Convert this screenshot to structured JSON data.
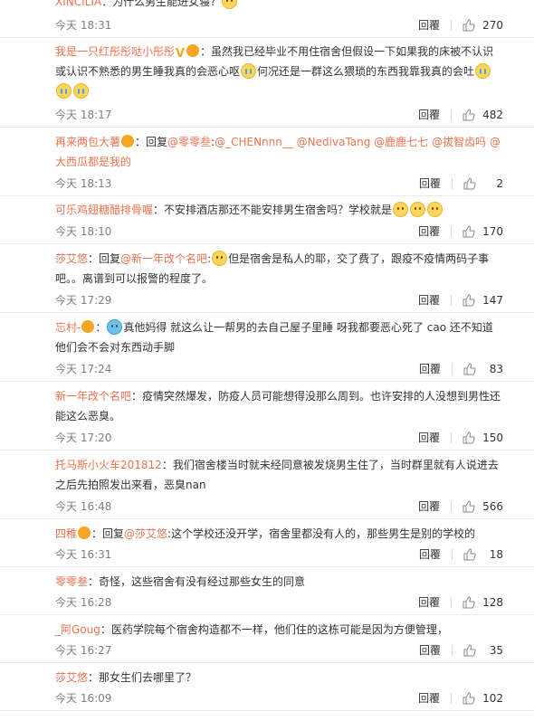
{
  "comments": [
    {
      "user": "XINCILIA",
      "parts": [
        {
          "t": "text",
          "v": "：为什么男生能进女寝？"
        },
        {
          "t": "emoji",
          "cls": ""
        }
      ],
      "time": "今天 18:31",
      "reply": "回覆",
      "likes": "270"
    },
    {
      "user": "我是一只红彤彤哒小彤彤",
      "badge": "V",
      "parts": [
        {
          "t": "text",
          "v": "：虽然我已经毕业不用住宿舍但假设一下如果我的床被不认识或认识不熟悉的男生睡我真的会恶心呕"
        },
        {
          "t": "emoji",
          "cls": "cry"
        },
        {
          "t": "text",
          "v": "何况还是一群这么猥琐的东西我靠我真的会吐"
        },
        {
          "t": "emoji",
          "cls": "cry"
        },
        {
          "t": "emoji",
          "cls": "cry"
        },
        {
          "t": "emoji",
          "cls": "cry"
        }
      ],
      "time": "今天 18:17",
      "reply": "回覆",
      "likes": "482"
    },
    {
      "user": "再来两包大薯",
      "parts": [
        {
          "t": "text",
          "v": "：回复"
        },
        {
          "t": "mention",
          "v": "@零零叁"
        },
        {
          "t": "text",
          "v": ":"
        },
        {
          "t": "mention",
          "v": "@_CHENnnn__ @NedivaTang @鹿鹿七七 @拔智齿吗 @大西瓜都是我的"
        }
      ],
      "time": "今天 18:13",
      "reply": "回覆",
      "likes": "2"
    },
    {
      "user": "可乐鸡翅糖醋排骨喔",
      "parts": [
        {
          "t": "text",
          "v": "：不安排酒店那还不能安排男生宿舍吗？学校就是"
        },
        {
          "t": "emoji",
          "cls": ""
        },
        {
          "t": "emoji",
          "cls": ""
        },
        {
          "t": "emoji",
          "cls": ""
        }
      ],
      "time": "今天 18:10",
      "reply": "回覆",
      "likes": "170"
    },
    {
      "user": "莎艾悠",
      "parts": [
        {
          "t": "text",
          "v": "：回复"
        },
        {
          "t": "mention",
          "v": "@新一年改个名吧"
        },
        {
          "t": "text",
          "v": ":"
        },
        {
          "t": "emoji",
          "cls": ""
        },
        {
          "t": "text",
          "v": "但是宿舍是私人的耶，交了费了，跟疫不疫情两码子事吧。。离谱到可以报警的程度了。"
        }
      ],
      "time": "今天 17:29",
      "reply": "回覆",
      "likes": "147"
    },
    {
      "user": "忘村-",
      "parts": [
        {
          "t": "text",
          "v": "："
        },
        {
          "t": "emoji",
          "cls": "blue"
        },
        {
          "t": "text",
          "v": "真他妈得 就这么让一帮男的去自己屋子里睡 呀我都要恶心死了 cao 还不知道他们会不会对东西动手脚"
        }
      ],
      "time": "今天 17:24",
      "reply": "回覆",
      "likes": "83"
    },
    {
      "user": "新一年改个名吧",
      "parts": [
        {
          "t": "text",
          "v": "：疫情突然爆发，防疫人员可能想得没那么周到。也许安排的人没想到男性还能这么恶臭。"
        }
      ],
      "time": "今天 17:20",
      "reply": "回覆",
      "likes": "150"
    },
    {
      "user": "托马斯小火车201812",
      "parts": [
        {
          "t": "text",
          "v": "：我们宿舍楼当时就未经同意被发烧男生住了，当时群里就有人说进去之后先拍照发出来看，恶臭nan"
        }
      ],
      "time": "今天 16:48",
      "reply": "回覆",
      "likes": "566"
    },
    {
      "user": "四稚",
      "parts": [
        {
          "t": "text",
          "v": "：回复"
        },
        {
          "t": "mention",
          "v": "@莎艾悠"
        },
        {
          "t": "text",
          "v": ":这个学校还没开学，宿舍里都没有人的，那些男生是别的学校的"
        }
      ],
      "time": "今天 16:31",
      "reply": "回覆",
      "likes": "18"
    },
    {
      "user": "零零叁",
      "parts": [
        {
          "t": "text",
          "v": "：奇怪，这些宿舍有没有经过那些女生的同意"
        }
      ],
      "time": "今天 16:28",
      "reply": "回覆",
      "likes": "128"
    },
    {
      "user": "_阿Goug",
      "parts": [
        {
          "t": "text",
          "v": "：医药学院每个宿舍构造都不一样，他们住的这栋可能是因为方便管理，"
        }
      ],
      "time": "今天 16:27",
      "reply": "回覆",
      "likes": "35"
    },
    {
      "user": "莎艾悠",
      "parts": [
        {
          "t": "text",
          "v": "：那女生们去哪里了？"
        }
      ],
      "time": "今天 16:09",
      "reply": "回覆",
      "likes": "102"
    }
  ],
  "icons": {
    "like": "thumbs-up-icon",
    "vip": "vip-icon",
    "verified": "verified-v-icon"
  },
  "colors": {
    "username": "#eb7350",
    "text": "#333333",
    "meta": "#808080"
  }
}
